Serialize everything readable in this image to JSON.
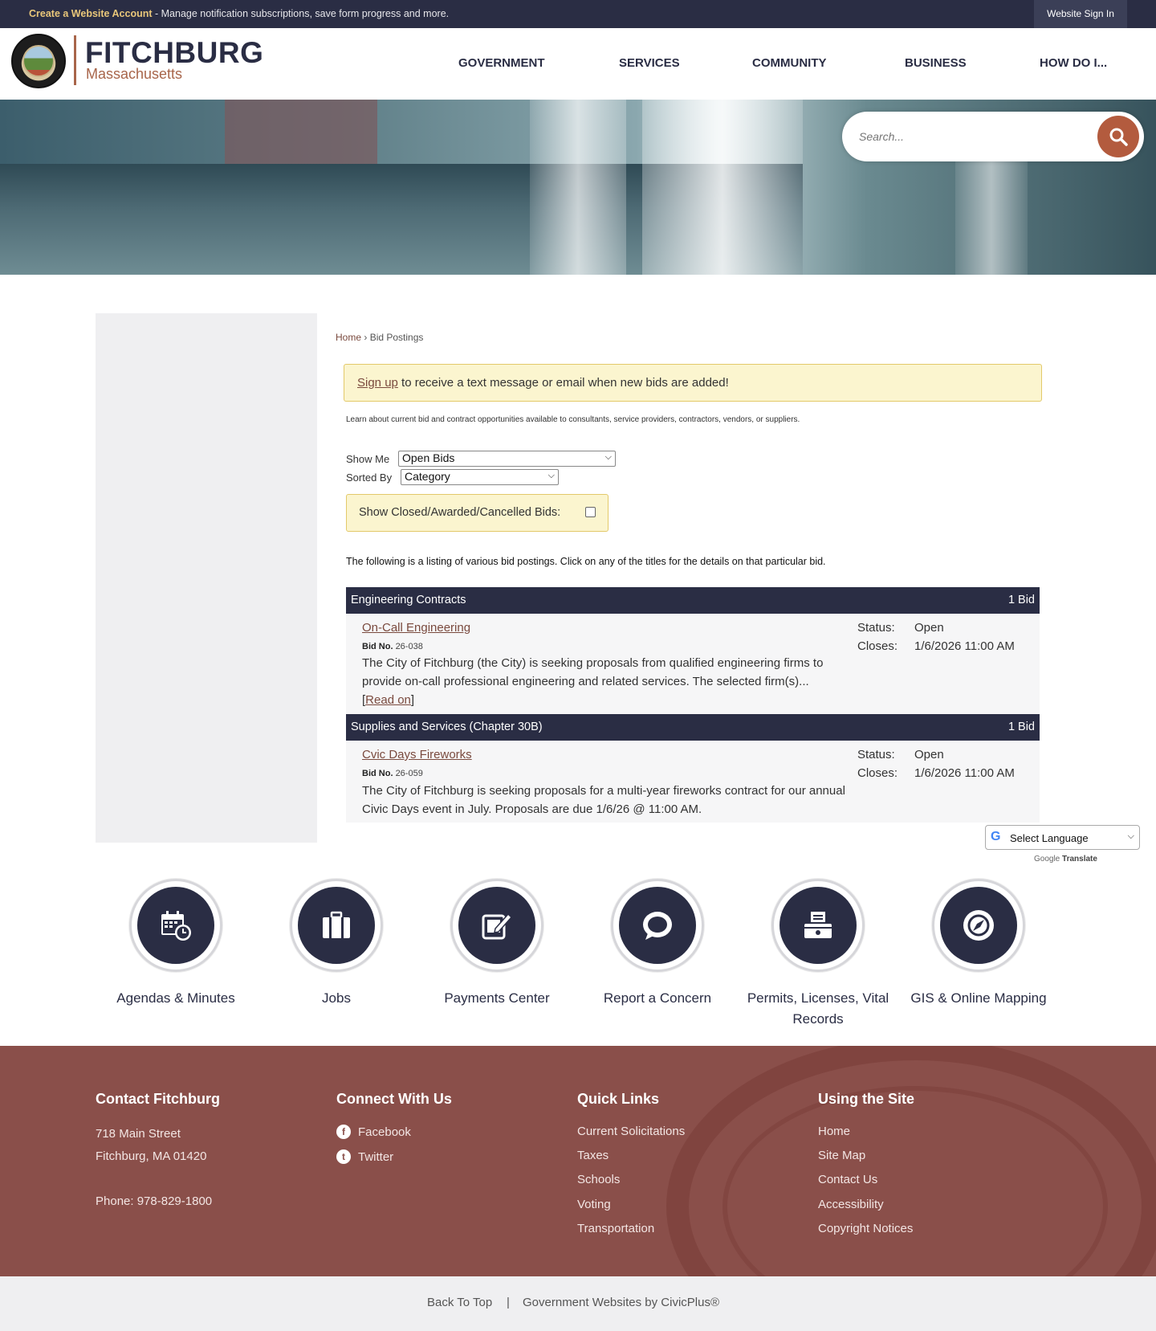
{
  "topbar": {
    "create_account": "Create a Website Account",
    "promo_text": " - Manage notification subscriptions, save form progress and more.",
    "sign_in": "Website Sign In"
  },
  "header": {
    "city": "FITCHBURG",
    "state": "Massachusetts",
    "nav": [
      "GOVERNMENT",
      "SERVICES",
      "COMMUNITY",
      "BUSINESS",
      "HOW DO I..."
    ]
  },
  "search": {
    "placeholder": "Search..."
  },
  "breadcrumb": {
    "home": "Home",
    "separator": "›",
    "current": "Bid Postings"
  },
  "alert": {
    "signup": "Sign up",
    "text": " to receive a text message or email when new bids are added!"
  },
  "intro": "Learn about current bid and contract opportunities available to consultants, service providers, contractors, vendors, or suppliers.",
  "filters": {
    "show_me_label": "Show Me",
    "show_me_value": "Open Bids",
    "sorted_by_label": "Sorted By",
    "sorted_by_value": "Category",
    "closed_label": "Show Closed/Awarded/Cancelled Bids:",
    "closed_checked": false
  },
  "listing_note": "The following is a listing of various bid postings. Click on any of the titles for the details on that particular bid.",
  "categories": [
    {
      "name": "Engineering Contracts",
      "count": "1 Bid",
      "bid": {
        "title": "On-Call Engineering",
        "no_label": "Bid No.",
        "no": "26-038",
        "desc": "The City of Fitchburg (the City) is seeking proposals from qualified engineering firms to provide on-call professional engineering and related services. The selected firm(s)...",
        "read_on": "Read on",
        "status_label": "Status:",
        "status": "Open",
        "closes_label": "Closes:",
        "closes": "1/6/2026 11:00 AM"
      }
    },
    {
      "name": "Supplies and Services (Chapter 30B)",
      "count": "1 Bid",
      "bid": {
        "title": "Cvic Days Fireworks",
        "no_label": "Bid No.",
        "no": "26-059",
        "desc": "The City of Fitchburg is seeking proposals for a multi-year fireworks contract for our annual Civic Days event in July. Proposals are due 1/6/26 @ 11:00 AM.",
        "status_label": "Status:",
        "status": "Open",
        "closes_label": "Closes:",
        "closes": "1/6/2026 11:00 AM"
      }
    }
  ],
  "translate": {
    "select": "Select Language",
    "powered": "Google",
    "translate": "Translate"
  },
  "quick_links": [
    {
      "label": "Agendas & Minutes",
      "icon": "calendar-clock-icon"
    },
    {
      "label": "Jobs",
      "icon": "briefcase-icon"
    },
    {
      "label": "Payments Center",
      "icon": "phone-pencil-icon"
    },
    {
      "label": "Report a Concern",
      "icon": "speech-bubble-icon"
    },
    {
      "label": "Permits, Licenses, Vital Records",
      "icon": "file-box-icon"
    },
    {
      "label": "GIS & Online Mapping",
      "icon": "compass-icon"
    }
  ],
  "footer": {
    "contact": {
      "heading": "Contact Fitchburg",
      "address1": "718 Main Street",
      "address2": "Fitchburg, MA 01420",
      "phone": "Phone: 978-829-1800"
    },
    "connect": {
      "heading": "Connect With Us",
      "facebook": "Facebook",
      "twitter": "Twitter"
    },
    "quick": {
      "heading": "Quick Links",
      "items": [
        "Current Solicitations",
        "Taxes",
        "Schools",
        "Voting",
        "Transportation"
      ]
    },
    "site": {
      "heading": "Using the Site",
      "items": [
        "Home",
        "Site Map",
        "Contact Us",
        "Accessibility",
        "Copyright Notices"
      ]
    }
  },
  "bottom": {
    "back_to_top": "Back To Top",
    "separator": "|",
    "civicplus": "Government Websites by CivicPlus®"
  },
  "colors": {
    "navy": "#2a2d44",
    "rust": "#b35b3e",
    "footer": "#8a4f4a",
    "alert_bg": "#fbf5cf"
  }
}
